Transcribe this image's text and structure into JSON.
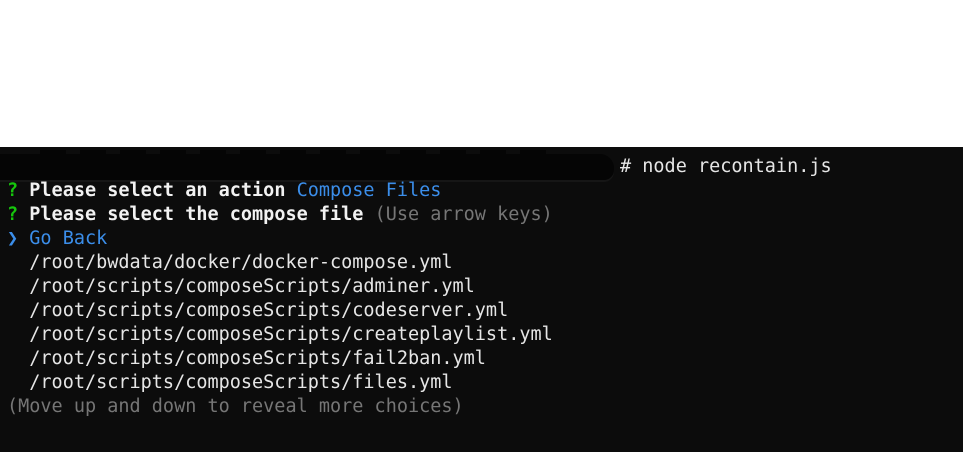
{
  "terminal": {
    "command": "# node recontain.js",
    "question1": {
      "mark": "?",
      "text": "Please select an action",
      "answer": "Compose Files"
    },
    "question2": {
      "mark": "?",
      "text": "Please select the compose file",
      "hint": "(Use arrow keys)"
    },
    "selected": {
      "pointer": "❯",
      "label": "Go Back"
    },
    "choices": [
      "/root/bwdata/docker/docker-compose.yml",
      "/root/scripts/composeScripts/adminer.yml",
      "/root/scripts/composeScripts/codeserver.yml",
      "/root/scripts/composeScripts/createplaylist.yml",
      "/root/scripts/composeScripts/fail2ban.yml",
      "/root/scripts/composeScripts/files.yml"
    ],
    "footer": "(Move up and down to reveal more choices)"
  },
  "colors": {
    "background": "#0c0c0c",
    "question_mark": "#16c60c",
    "accent": "#3b8eea",
    "dim": "#767676"
  }
}
